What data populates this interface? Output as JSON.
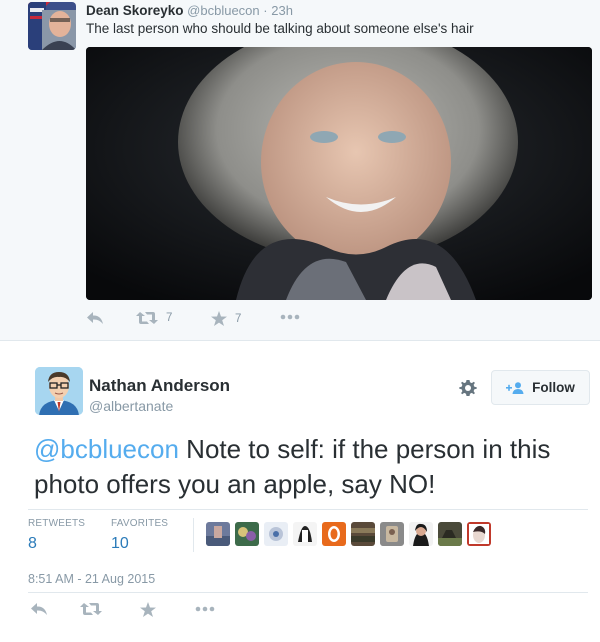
{
  "parent_tweet": {
    "name": "Dean Skoreyko",
    "handle": "@bcbluecon",
    "dot": "·",
    "time": "23h",
    "text": "The last person who should be talking about someone else's hair",
    "retweet_count": "7",
    "favorite_count": "7"
  },
  "main_tweet": {
    "name": "Nathan Anderson",
    "handle": "@albertanate",
    "follow_label": "Follow",
    "mention": "@bcbluecon",
    "text": " Note to self: if the person in this photo offers you an apple, say NO!",
    "stats": {
      "retweets_label": "RETWEETS",
      "retweets_value": "8",
      "favorites_label": "FAVORITES",
      "favorites_value": "10"
    },
    "timestamp": "8:51 AM - 21 Aug 2015"
  },
  "colors": {
    "link": "#55acee",
    "stat_value": "#2b7bb9",
    "muted": "#8899a6",
    "action_icon": "#a8b4bd",
    "parent_bg": "#f5f8fa"
  },
  "icons": [
    "reply-icon",
    "retweet-icon",
    "favorite-icon",
    "more-icon",
    "gear-icon",
    "follow-person-icon"
  ]
}
